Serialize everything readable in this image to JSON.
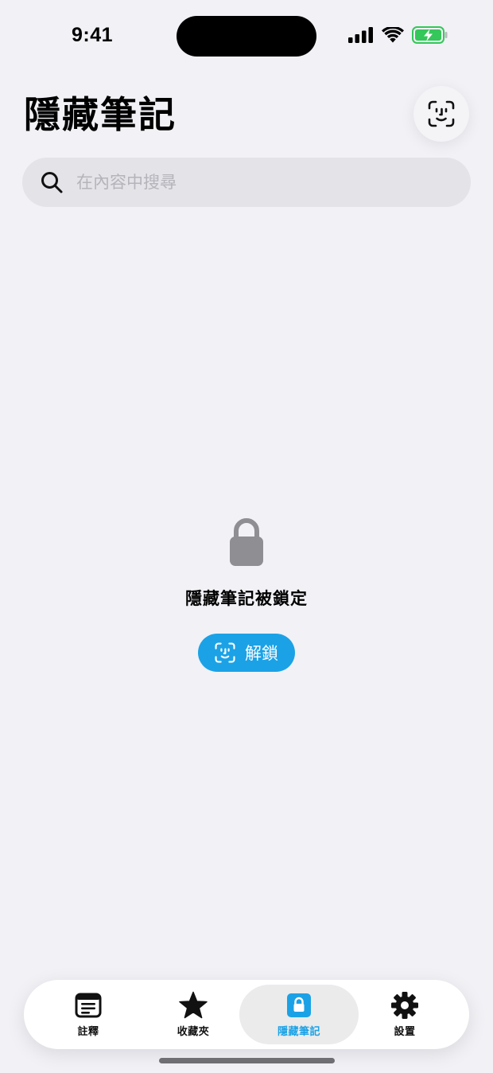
{
  "status_bar": {
    "time": "9:41"
  },
  "header": {
    "title": "隱藏筆記"
  },
  "search": {
    "placeholder": "在內容中搜尋"
  },
  "locked_state": {
    "message": "隱藏筆記被鎖定",
    "unlock_label": "解鎖"
  },
  "tab_bar": {
    "tabs": [
      {
        "label": "註釋",
        "icon": "notes-icon",
        "active": false
      },
      {
        "label": "收藏夾",
        "icon": "star-icon",
        "active": false
      },
      {
        "label": "隱藏筆記",
        "icon": "lock-icon",
        "active": true
      },
      {
        "label": "設置",
        "icon": "gear-icon",
        "active": false
      }
    ]
  },
  "colors": {
    "accent": "#1ba2e6",
    "background": "#f1f1f6",
    "battery_green": "#34c759",
    "lock_gray": "#8e8e93"
  }
}
